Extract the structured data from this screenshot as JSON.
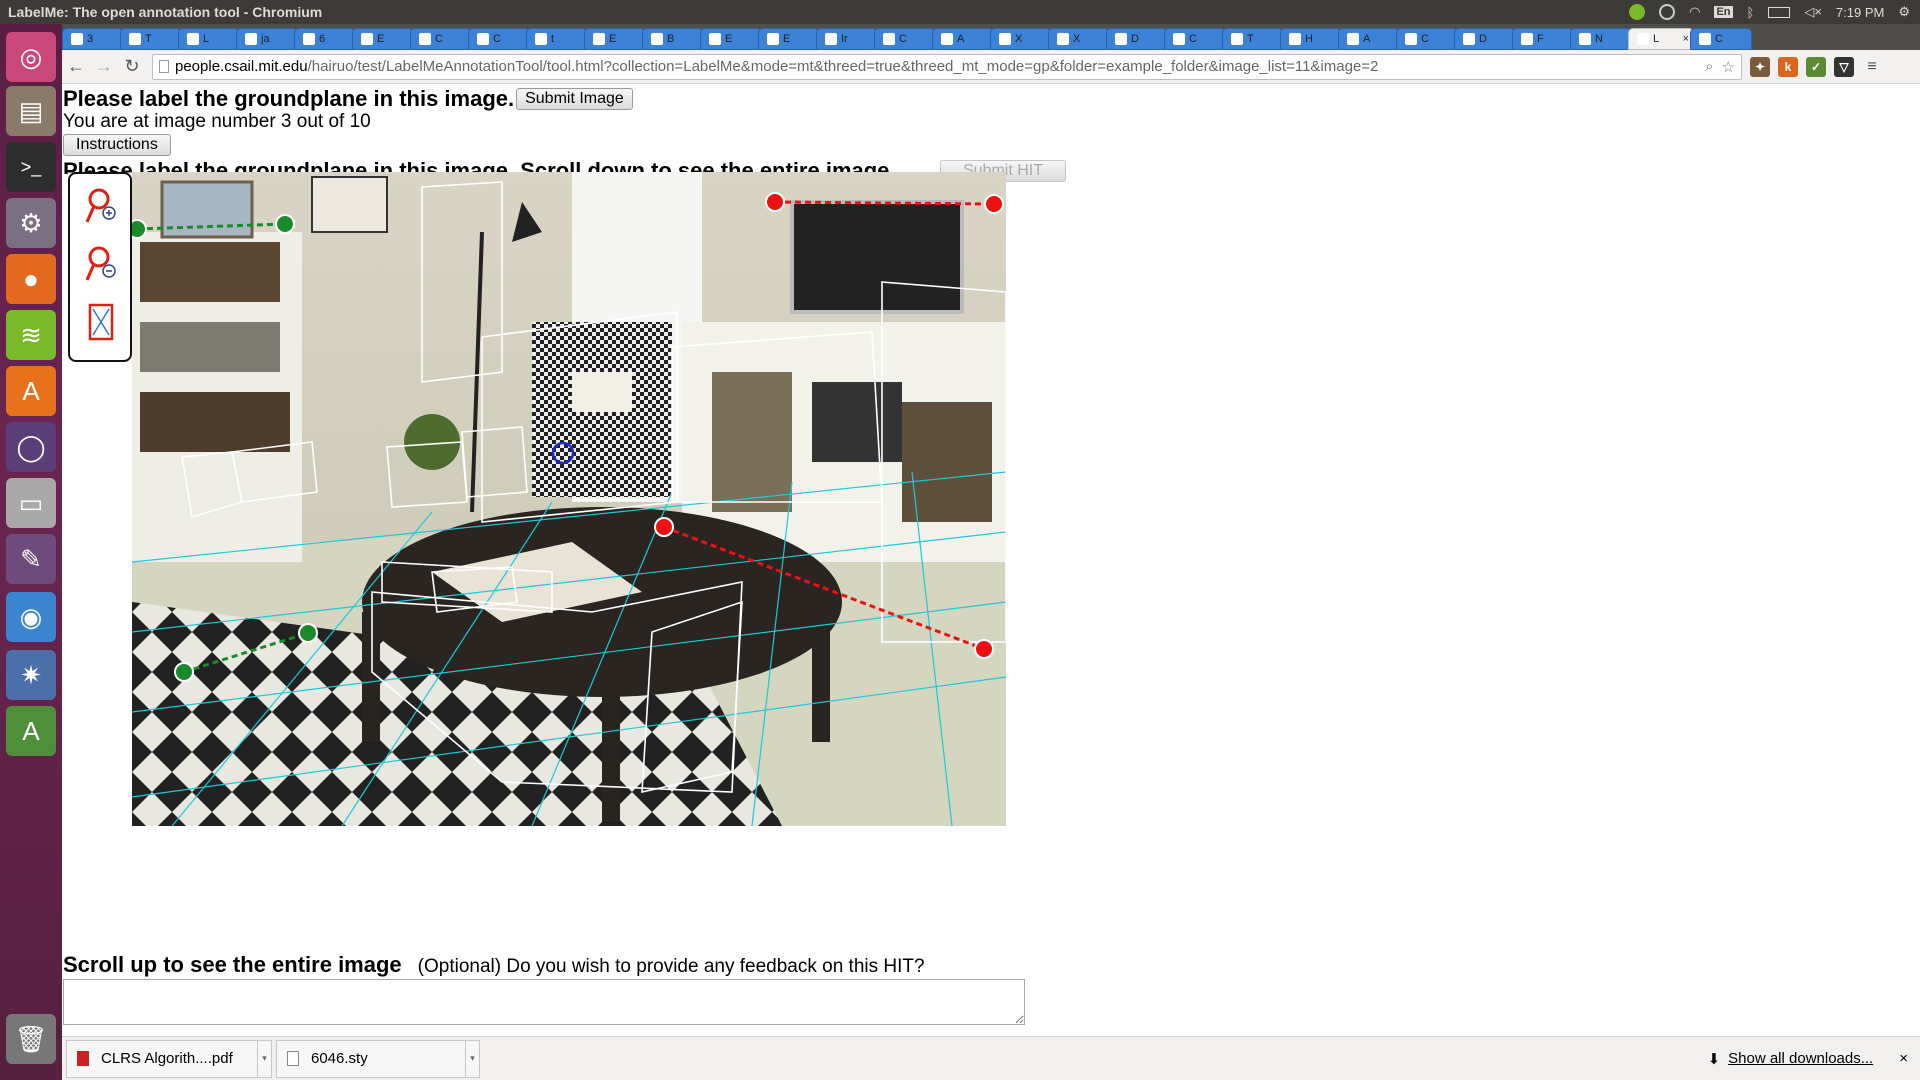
{
  "window": {
    "title": "LabelMe: The open annotation tool - Chromium"
  },
  "panel": {
    "time": "7:19 PM",
    "keyboard": "En"
  },
  "tabs": [
    {
      "label": "3"
    },
    {
      "label": "T"
    },
    {
      "label": "L"
    },
    {
      "label": "ja"
    },
    {
      "label": "6"
    },
    {
      "label": "E"
    },
    {
      "label": "C"
    },
    {
      "label": "C"
    },
    {
      "label": "t"
    },
    {
      "label": "E"
    },
    {
      "label": "B"
    },
    {
      "label": "E"
    },
    {
      "label": "E"
    },
    {
      "label": "Ir"
    },
    {
      "label": "C"
    },
    {
      "label": "A"
    },
    {
      "label": "X"
    },
    {
      "label": "X"
    },
    {
      "label": "D"
    },
    {
      "label": "C"
    },
    {
      "label": "T"
    },
    {
      "label": "H"
    },
    {
      "label": "A"
    },
    {
      "label": "C"
    },
    {
      "label": "D"
    },
    {
      "label": "F"
    },
    {
      "label": "N"
    },
    {
      "label": "L",
      "active": true
    },
    {
      "label": "C"
    }
  ],
  "address": {
    "host": "people.csail.mit.edu",
    "path": "/hairuo/test/LabelMeAnnotationTool/tool.html?collection=LabelMe&mode=mt&threed=true&threed_mt_mode=gp&folder=example_folder&image_list=11&image=2"
  },
  "page": {
    "heading": "Please label the groundplane in this image.",
    "submit_image": "Submit Image",
    "progress_text": "You are at image number 3 out of 10",
    "instructions_button": "Instructions",
    "heading_scroll": "Please label the groundplane in this image. Scroll down to see the entire image.",
    "submit_hit": "Submit HIT",
    "scroll_up": "Scroll up to see the entire image",
    "feedback_prompt": "(Optional) Do you wish to provide any feedback on this HIT?",
    "feedback_value": ""
  },
  "downloads": {
    "items": [
      {
        "name": "CLRS Algorith....pdf"
      },
      {
        "name": "6046.sty"
      }
    ],
    "show_all": "Show all downloads..."
  }
}
